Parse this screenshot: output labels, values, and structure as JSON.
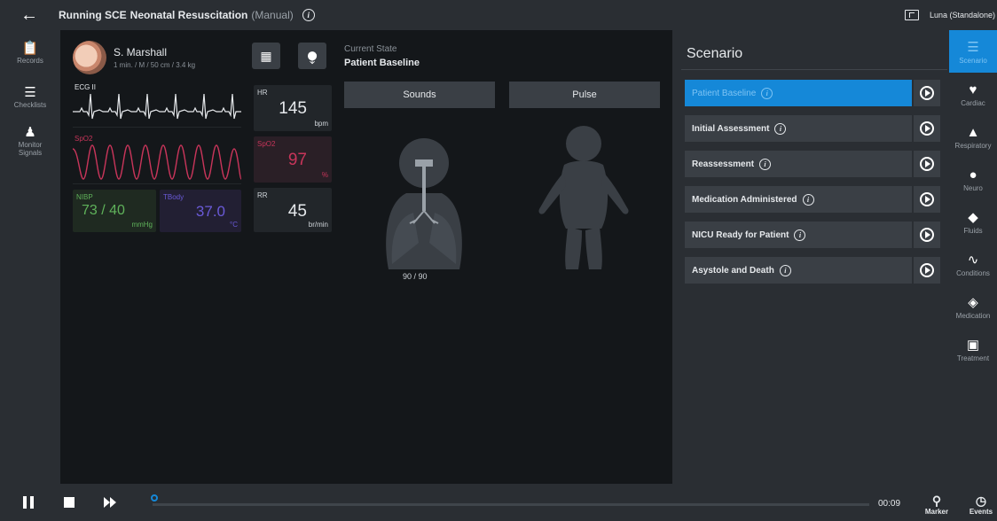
{
  "topbar": {
    "running_label": "Running SCE",
    "scenario_name": "Neonatal Resuscitation",
    "mode": "(Manual)",
    "device": "Luna (Standalone)"
  },
  "left_nav": [
    {
      "label": "Records",
      "icon": "clipboard-icon"
    },
    {
      "label": "Checklists",
      "icon": "checklist-icon"
    },
    {
      "label": "Monitor Signals",
      "icon": "person-add-icon"
    }
  ],
  "patient": {
    "name": "S. Marshall",
    "details": "1 min. / M / 50 cm / 3.4 kg"
  },
  "waveforms": {
    "ecg_label": "ECG II",
    "spo2_label": "SpO2"
  },
  "vitals": {
    "hr": {
      "label": "HR",
      "value": "145",
      "unit": "bpm"
    },
    "spo2": {
      "label": "SpO2",
      "value": "97",
      "unit": "%"
    },
    "rr": {
      "label": "RR",
      "value": "45",
      "unit": "br/min"
    },
    "nibp": {
      "label": "NIBP",
      "value": "73 / 40",
      "unit": "mmHg"
    },
    "tbody": {
      "label": "TBody",
      "value": "37.0",
      "unit": "°C"
    }
  },
  "current_state": {
    "label": "Current State",
    "value": "Patient Baseline"
  },
  "tabs": {
    "sounds": "Sounds",
    "pulse": "Pulse"
  },
  "lung_reading": "90 / 90",
  "scenario": {
    "title": "Scenario",
    "states": [
      {
        "label": "Patient Baseline",
        "active": true
      },
      {
        "label": "Initial Assessment",
        "active": false
      },
      {
        "label": "Reassessment",
        "active": false
      },
      {
        "label": "Medication Administered",
        "active": false
      },
      {
        "label": "NICU Ready for Patient",
        "active": false
      },
      {
        "label": "Asystole and Death",
        "active": false
      }
    ]
  },
  "right_nav": [
    {
      "label": "Scenario",
      "icon": "list-icon",
      "active": true
    },
    {
      "label": "Cardiac",
      "icon": "heart-icon"
    },
    {
      "label": "Respiratory",
      "icon": "lungs-icon"
    },
    {
      "label": "Neuro",
      "icon": "brain-icon"
    },
    {
      "label": "Fluids",
      "icon": "drop-icon"
    },
    {
      "label": "Conditions",
      "icon": "pulse-icon"
    },
    {
      "label": "Medication",
      "icon": "pill-icon"
    },
    {
      "label": "Treatment",
      "icon": "medkit-icon"
    }
  ],
  "bottom": {
    "elapsed": "00:09",
    "marker_label": "Marker",
    "events_label": "Events"
  },
  "colors": {
    "accent": "#1588d8",
    "ecg": "#e6e9ec",
    "spo2": "#c8355a",
    "nibp": "#5fb25a",
    "tbody": "#6a5ad8"
  }
}
